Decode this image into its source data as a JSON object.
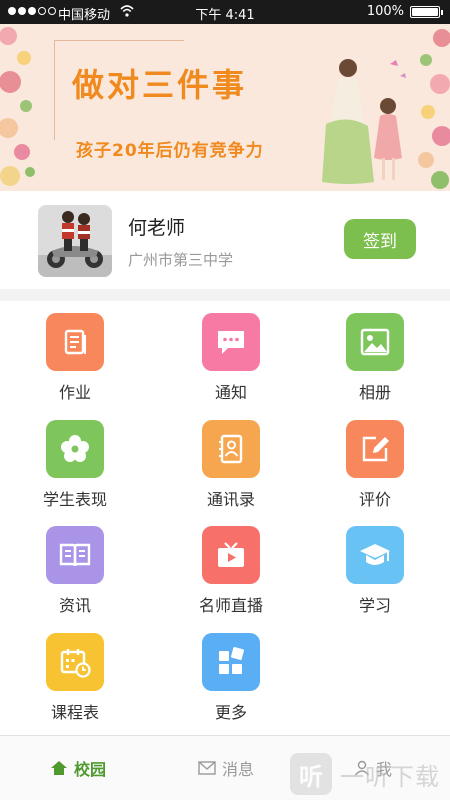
{
  "status_bar": {
    "carrier": "中国移动",
    "time": "下午 4:41",
    "battery": "100%",
    "battery_level": 1.0
  },
  "banner": {
    "title": "做对三件事",
    "subtitle": "孩子20年后仍有竞争力"
  },
  "profile": {
    "name": "何老师",
    "school": "广州市第三中学",
    "checkin_label": "签到"
  },
  "menu": [
    {
      "label": "作业",
      "icon": "homework-book-icon",
      "color": "#f8875b"
    },
    {
      "label": "通知",
      "icon": "notice-chat-icon",
      "color": "#f77aa5"
    },
    {
      "label": "相册",
      "icon": "album-image-icon",
      "color": "#7ec65b"
    },
    {
      "label": "学生表现",
      "icon": "performance-flower-icon",
      "color": "#7ec65b"
    },
    {
      "label": "通讯录",
      "icon": "contacts-book-icon",
      "color": "#f6a64e"
    },
    {
      "label": "评价",
      "icon": "evaluate-edit-icon",
      "color": "#f8875b"
    },
    {
      "label": "资讯",
      "icon": "news-book-icon",
      "color": "#a994e8"
    },
    {
      "label": "名师直播",
      "icon": "live-tv-icon",
      "color": "#f7706a"
    },
    {
      "label": "学习",
      "icon": "study-cap-icon",
      "color": "#68c3f4"
    },
    {
      "label": "课程表",
      "icon": "schedule-calendar-icon",
      "color": "#f7c332"
    },
    {
      "label": "更多",
      "icon": "more-blocks-icon",
      "color": "#5aaef4"
    }
  ],
  "tabs": [
    {
      "label": "校园",
      "icon": "home-icon",
      "active": true
    },
    {
      "label": "消息",
      "icon": "mail-icon",
      "active": false
    },
    {
      "label": "我",
      "icon": "person-icon",
      "active": false
    }
  ],
  "watermark": {
    "icon_text": "听",
    "text": "一听下载"
  }
}
